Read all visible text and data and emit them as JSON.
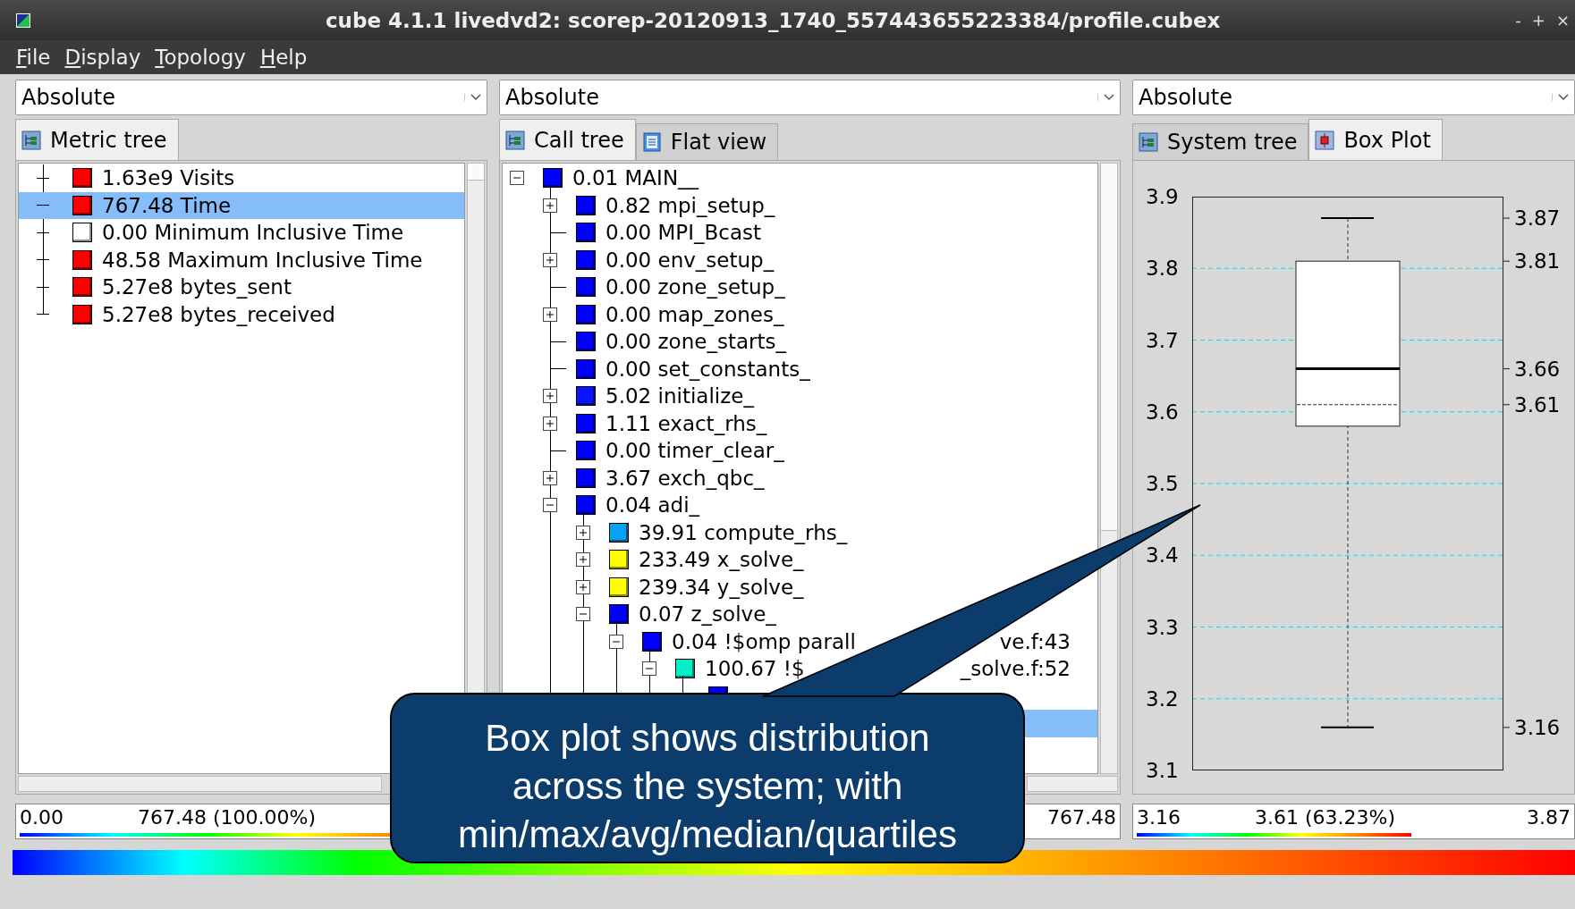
{
  "window": {
    "title": "cube 4.1.1 livedvd2: scorep-20120913_1740_557443655223384/profile.cubex",
    "controls": [
      "-",
      "+",
      "×"
    ]
  },
  "menu": [
    "File",
    "Display",
    "Topology",
    "Help"
  ],
  "panels": [
    {
      "combo": {
        "value": "Absolute"
      },
      "tabs": [
        {
          "label": "Metric tree",
          "selected": true
        }
      ],
      "tree": [
        {
          "label": "1.63e9 Visits",
          "color": "#ff0000",
          "selected": false
        },
        {
          "label": "767.48 Time",
          "color": "#ff0000",
          "selected": true
        },
        {
          "label": "0.00 Minimum Inclusive Time",
          "color": "#ffffff",
          "selected": false
        },
        {
          "label": "48.58 Maximum Inclusive Time",
          "color": "#ff0000",
          "selected": false
        },
        {
          "label": "5.27e8 bytes_sent",
          "color": "#ff0000",
          "selected": false
        },
        {
          "label": "5.27e8 bytes_received",
          "color": "#ff0000",
          "selected": false
        }
      ],
      "value_bar": {
        "min": "0.00",
        "value": "767.48 (100.00%)",
        "level": 1
      }
    },
    {
      "combo": {
        "value": "Absolute"
      },
      "tabs": [
        {
          "label": "Call tree",
          "selected": true
        },
        {
          "label": "Flat view",
          "selected": false
        }
      ],
      "tree": [
        {
          "label": "0.01 MAIN__",
          "color": "#0000ff",
          "selected": false,
          "expanded": true,
          "children": [
            {
              "label": "0.82 mpi_setup_",
              "color": "#0000ff",
              "selected": false,
              "expanded": false
            },
            {
              "label": "0.00 MPI_Bcast",
              "color": "#0000ff",
              "selected": false
            },
            {
              "label": "0.00 env_setup_",
              "color": "#0000ff",
              "selected": false,
              "expanded": false
            },
            {
              "label": "0.00 zone_setup_",
              "color": "#0000ff",
              "selected": false
            },
            {
              "label": "0.00 map_zones_",
              "color": "#0000ff",
              "selected": false,
              "expanded": false
            },
            {
              "label": "0.00 zone_starts_",
              "color": "#0000ff",
              "selected": false
            },
            {
              "label": "0.00 set_constants_",
              "color": "#0000ff",
              "selected": false
            },
            {
              "label": "5.02 initialize_",
              "color": "#0a14ff",
              "selected": false,
              "expanded": false
            },
            {
              "label": "1.11 exact_rhs_",
              "color": "#0000ff",
              "selected": false,
              "expanded": false
            },
            {
              "label": "0.00 timer_clear_",
              "color": "#0000ff",
              "selected": false
            },
            {
              "label": "3.67 exch_qbc_",
              "color": "#0000ff",
              "selected": false,
              "expanded": false
            },
            {
              "label": "0.04 adi_",
              "color": "#0000ff",
              "selected": false,
              "expanded": true,
              "children": [
                {
                  "label": "39.91 compute_rhs_",
                  "color": "#0aa0f5",
                  "selected": false,
                  "expanded": false
                },
                {
                  "label": "233.49 x_solve_",
                  "color": "#ffff00",
                  "selected": false,
                  "expanded": false
                },
                {
                  "label": "239.34 y_solve_",
                  "color": "#ffff00",
                  "selected": false,
                  "expanded": false
                },
                {
                  "label": "0.07 z_solve_",
                  "color": "#0000ff",
                  "selected": false,
                  "expanded": true,
                  "children": [
                    {
                      "label": "0.04 !$omp parall",
                      "label_end": "ve.f:43",
                      "color": "#0000ff",
                      "selected": false,
                      "expanded": true,
                      "children": [
                        {
                          "label": "100.67 !$",
                          "label_end": "_solve.f:52",
                          "color": "#00f0c8",
                          "selected": false,
                          "expanded": true,
                          "children": [
                            {
                              "color": "#0000ff",
                              "selected": false
                            },
                            {
                              "selected": true
                            }
                          ]
                        }
                      ]
                    }
                  ]
                }
              ]
            }
          ]
        }
      ],
      "value_bar": {
        "value": "767.48"
      }
    },
    {
      "combo": {
        "value": "Absolute"
      },
      "tabs": [
        {
          "label": "System tree",
          "selected": false
        },
        {
          "label": "Box Plot",
          "selected": true
        }
      ],
      "box_plot": {
        "y_ticks": [
          "3.9",
          "3.8",
          "3.7",
          "3.6",
          "3.5",
          "3.4",
          "3.3",
          "3.2",
          "3.1"
        ],
        "stats": [
          {
            "kind": "max",
            "label": "3.87"
          },
          {
            "kind": "q3",
            "label": "3.81"
          },
          {
            "kind": "median",
            "label": "3.66"
          },
          {
            "kind": "mean",
            "label": "3.61"
          },
          {
            "kind": "q1",
            "level": 0.6
          },
          {
            "kind": "min",
            "label": "3.16"
          }
        ]
      },
      "value_bar": {
        "min": "3.16",
        "value": "3.61 (63.23%)",
        "max": "3.87",
        "level": 0.6323
      }
    }
  ],
  "callout": {
    "text": "Box plot shows distribution across the system; with min/max/avg/median/quartiles"
  }
}
